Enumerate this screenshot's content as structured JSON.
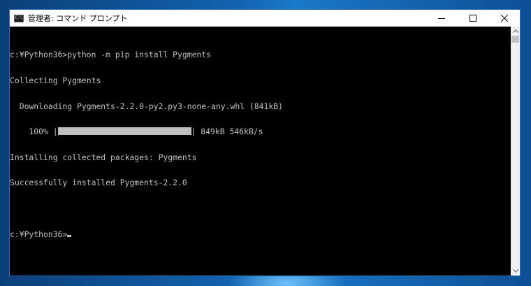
{
  "window": {
    "title": "管理者: コマンド プロンプト",
    "icon_label": "C:\\"
  },
  "console": {
    "lines": [
      "c:¥Python36>python -m pip install Pygments",
      "Collecting Pygments",
      "  Downloading Pygments-2.2.0-py2.py3-none-any.whl (841kB)",
      "    100% |",
      "Installing collected packages: Pygments",
      "Successfully installed Pygments-2.2.0",
      "",
      "c:¥Python36>"
    ],
    "progress_suffix": "| 849kB 546kB/s",
    "progress_percent": 100
  },
  "icons": {
    "minimize": "minimize-icon",
    "maximize": "maximize-icon",
    "close": "close-icon",
    "scroll_up": "chevron-up-icon",
    "scroll_down": "chevron-down-icon"
  }
}
